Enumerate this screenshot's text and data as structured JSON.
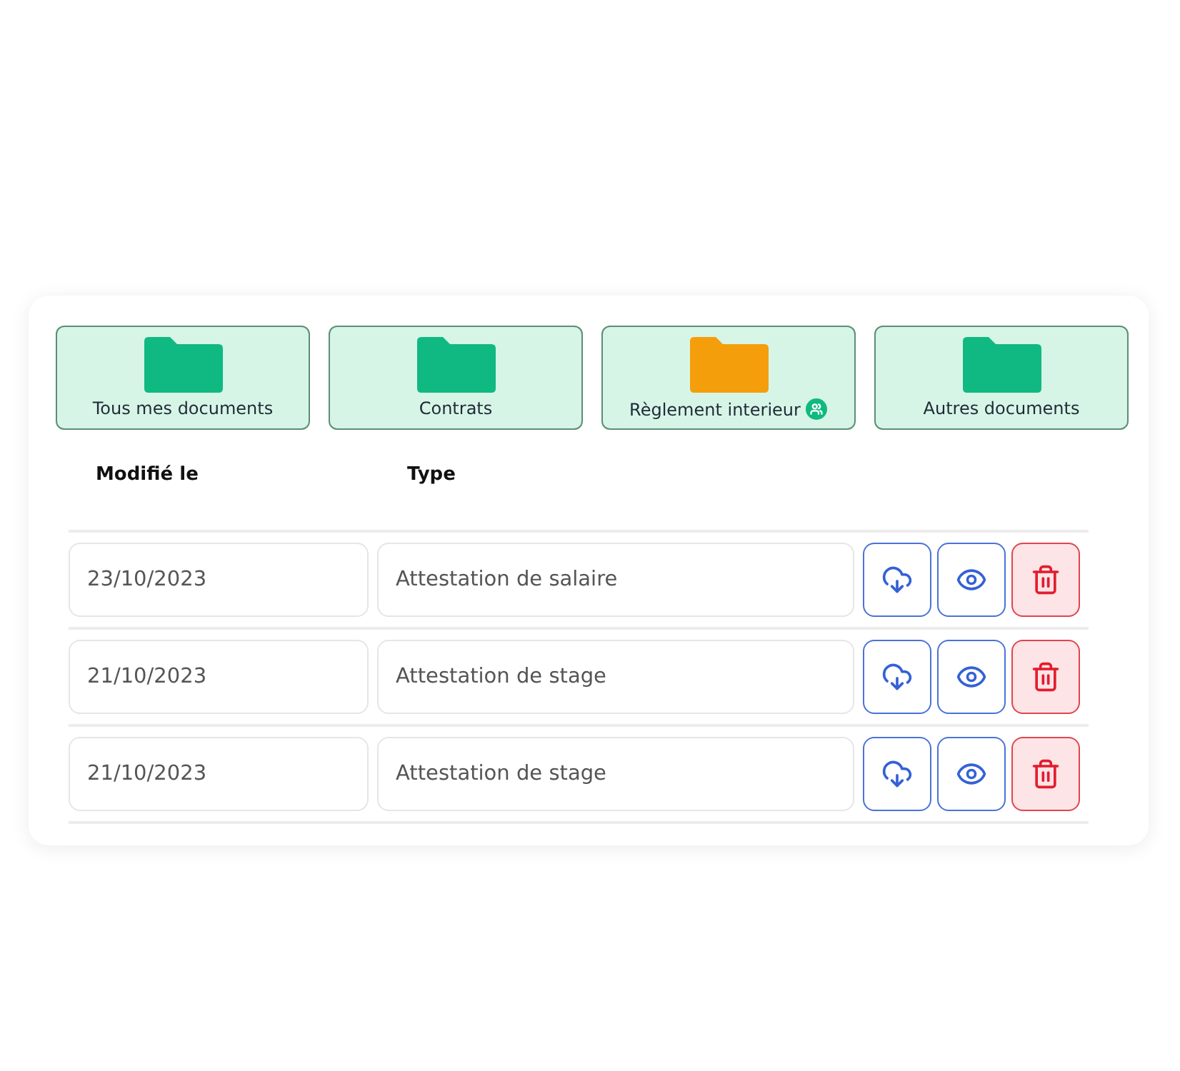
{
  "folders": [
    {
      "label": "Tous mes documents",
      "color": "#10b981",
      "shared": false
    },
    {
      "label": "Contrats",
      "color": "#10b981",
      "shared": false
    },
    {
      "label": "Règlement interieur",
      "color": "#f59e0b",
      "shared": true
    },
    {
      "label": "Autres documents",
      "color": "#10b981",
      "shared": false
    }
  ],
  "table": {
    "columns": [
      "Modifié le",
      "Type"
    ],
    "rows": [
      {
        "date": "23/10/2023",
        "type": "Attestation de salaire"
      },
      {
        "date": "21/10/2023",
        "type": "Attestation de stage"
      },
      {
        "date": "21/10/2023",
        "type": "Attestation de stage"
      }
    ]
  }
}
